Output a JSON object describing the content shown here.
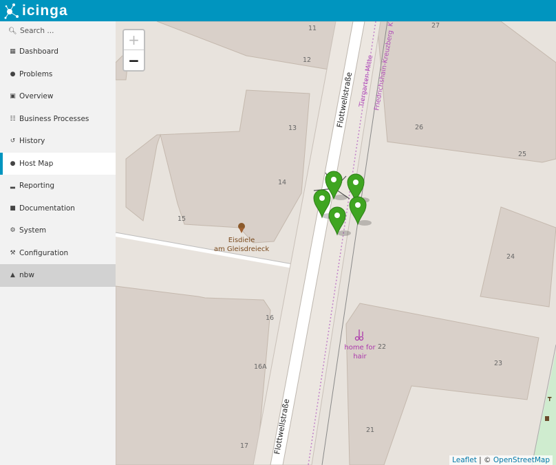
{
  "app": {
    "logo_text": "icinga"
  },
  "sidebar": {
    "search_placeholder": "Search ...",
    "items": [
      {
        "label": "Dashboard",
        "icon": "dashboard-icon"
      },
      {
        "label": "Problems",
        "icon": "problems-icon"
      },
      {
        "label": "Overview",
        "icon": "overview-icon"
      },
      {
        "label": "Business Processes",
        "icon": "sitemap-icon"
      },
      {
        "label": "History",
        "icon": "history-icon"
      },
      {
        "label": "Host Map",
        "icon": "globe-icon",
        "active": true
      },
      {
        "label": "Reporting",
        "icon": "reporting-icon"
      },
      {
        "label": "Documentation",
        "icon": "book-icon"
      },
      {
        "label": "System",
        "icon": "cogs-icon"
      },
      {
        "label": "Configuration",
        "icon": "wrench-icon"
      }
    ],
    "user": {
      "label": "nbw",
      "icon": "user-icon"
    }
  },
  "map": {
    "zoom_in": "+",
    "zoom_out": "−",
    "labels": {
      "street_top": "Flottwellstraße",
      "street_bottom": "Flottwellstraße",
      "district": "Tiergarten-Mitte",
      "district2": "Friedrichshain-Kreuzberg",
      "district_cut": "K",
      "cafe_line1": "Eisdiele",
      "cafe_line2": "am Gleisdreieck",
      "hair_line1": "home for",
      "hair_line2": "hair"
    },
    "house_numbers": [
      "11",
      "12",
      "13",
      "14",
      "15",
      "16",
      "16A",
      "17",
      "21",
      "22",
      "23",
      "24",
      "25",
      "26",
      "27"
    ],
    "markers_count": 5,
    "marker_color": "#3fa521",
    "attribution": {
      "leaflet": "Leaflet",
      "sep": " | © ",
      "osm": "OpenStreetMap"
    }
  },
  "colors": {
    "brand": "#0095bf",
    "building": "#d9d0c9",
    "road": "#ffffff"
  }
}
